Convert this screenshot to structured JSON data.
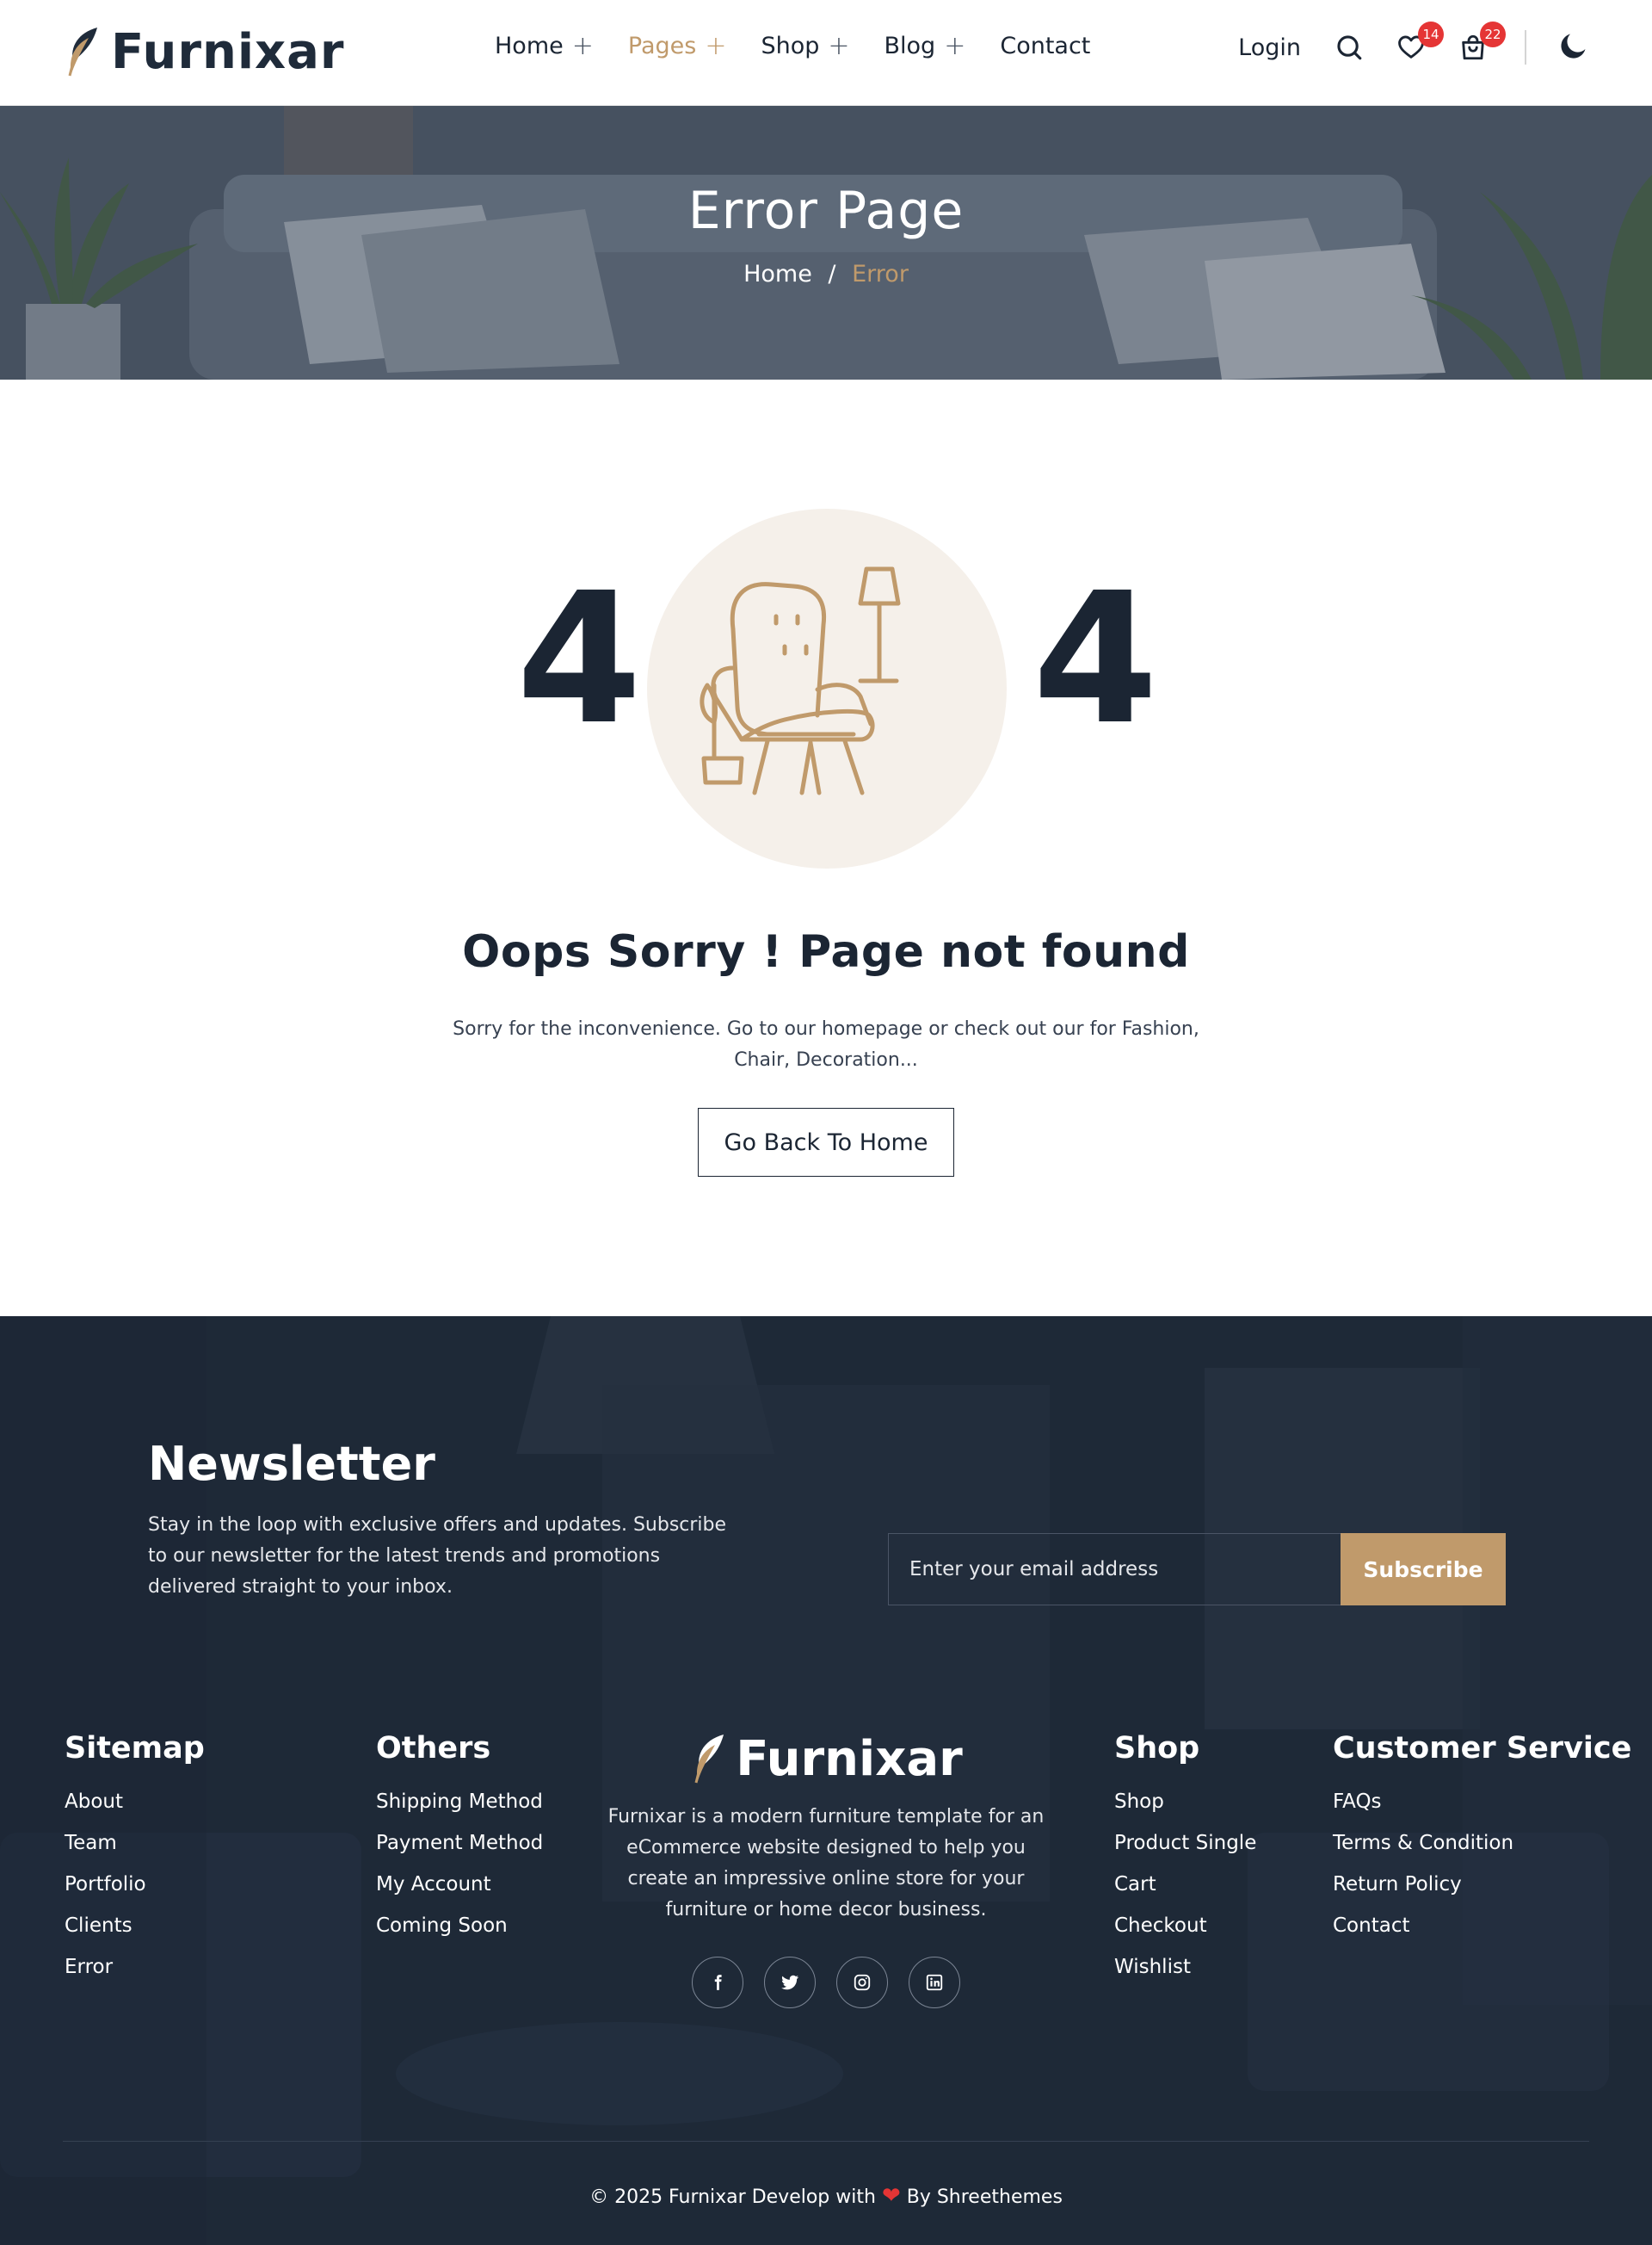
{
  "header": {
    "brand": "Furnixar",
    "nav": [
      {
        "label": "Home",
        "expand": "+"
      },
      {
        "label": "Pages",
        "expand": "+"
      },
      {
        "label": "Shop",
        "expand": "+"
      },
      {
        "label": "Blog",
        "expand": "+"
      },
      {
        "label": "Contact"
      }
    ],
    "login_label": "Login",
    "wishlist_count": "14",
    "cart_count": "22",
    "active_color": "#c09a6b"
  },
  "hero": {
    "title": "Error Page",
    "breadcrumb": {
      "home": "Home",
      "separator": "/",
      "current": "Error"
    }
  },
  "error": {
    "digit_left": "4",
    "digit_right": "4",
    "title": "Oops Sorry ! Page not found",
    "description": "Sorry for the inconvenience. Go to our homepage or check out our for Fashion, Chair, Decoration...",
    "button_label": "Go Back To Home"
  },
  "newsletter": {
    "title": "Newsletter",
    "description": "Stay in the loop with exclusive offers and updates. Subscribe to our newsletter for the latest trends and promotions delivered straight to your inbox.",
    "placeholder": "Enter your email address",
    "button_label": "Subscribe"
  },
  "footer": {
    "sitemap": {
      "title": "Sitemap",
      "links": [
        "About",
        "Team",
        "Portfolio",
        "Clients",
        "Error"
      ]
    },
    "others": {
      "title": "Others",
      "links": [
        "Shipping Method",
        "Payment Method",
        "My Account",
        "Coming Soon"
      ]
    },
    "brand": {
      "name": "Furnixar",
      "description": "Furnixar is a modern furniture template for an eCommerce website designed to help you create an impressive online store for your furniture or home decor business."
    },
    "socials": [
      "facebook-icon",
      "twitter-icon",
      "instagram-icon",
      "linkedin-icon"
    ],
    "shop": {
      "title": "Shop",
      "links": [
        "Shop",
        "Product Single",
        "Cart",
        "Checkout",
        "Wishlist"
      ]
    },
    "customer_service": {
      "title": "Customer Service",
      "links": [
        "FAQs",
        "Terms & Condition",
        "Return Policy",
        "Contact"
      ]
    },
    "copyright_prefix": "© 2025 Furnixar Develop with",
    "copyright_suffix": "By Shreethemes"
  },
  "colors": {
    "accent": "#c09a6b",
    "dark": "#1b2533",
    "footer_bg": "#1e2937",
    "badge": "#e53535"
  }
}
